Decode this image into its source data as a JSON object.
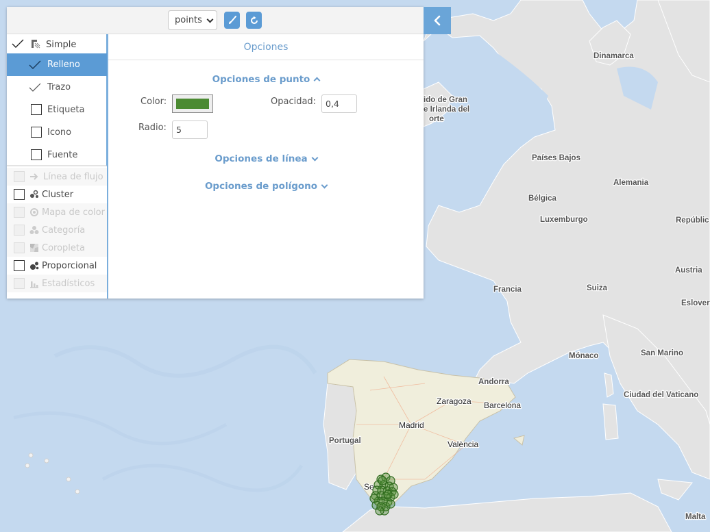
{
  "toolbar": {
    "layer_select_value": "points",
    "style_button_icon": "brush-icon",
    "reset_button_icon": "refresh-icon",
    "collapse_icon": "chevron-left-icon"
  },
  "sidebar": {
    "simple": {
      "label": "Simple",
      "checked": true
    },
    "subitems": [
      {
        "label": "Relleno",
        "checked": true,
        "active": true
      },
      {
        "label": "Trazo",
        "checked": true,
        "active": false
      },
      {
        "label": "Etiqueta",
        "checked": false,
        "active": false
      },
      {
        "label": "Icono",
        "checked": false,
        "active": false
      },
      {
        "label": "Fuente",
        "checked": false,
        "active": false
      }
    ],
    "types": [
      {
        "label": "Línea de flujo",
        "enabled": false,
        "icon": "arrow-right-icon"
      },
      {
        "label": "Cluster",
        "enabled": true,
        "icon": "cluster-icon"
      },
      {
        "label": "Mapa de color",
        "enabled": false,
        "icon": "heatmap-icon"
      },
      {
        "label": "Categoría",
        "enabled": false,
        "icon": "category-icon"
      },
      {
        "label": "Coropleta",
        "enabled": false,
        "icon": "choropleth-icon"
      },
      {
        "label": "Proporcional",
        "enabled": true,
        "icon": "proportional-icon"
      },
      {
        "label": "Estadísticos",
        "enabled": false,
        "icon": "bar-chart-icon"
      }
    ]
  },
  "options": {
    "header": "Opciones",
    "point_section": "Opciones de punto",
    "color_label": "Color:",
    "color_value": "#4b8a32",
    "opacity_label": "Opacidad:",
    "opacity_value": "0,4",
    "radius_label": "Radio:",
    "radius_value": "5",
    "line_section": "Opciones de línea",
    "polygon_section": "Opciones de polígono"
  },
  "map": {
    "labels": {
      "dinamarca": "Dinamarca",
      "uk_1": "ido de Gran",
      "uk_2": "e Irlanda del",
      "uk_3": "orte",
      "paises_bajos": "Países Bajos",
      "alemania": "Alemania",
      "belgica": "Bélgica",
      "luxemburgo": "Luxemburgo",
      "republica": "Repúblic",
      "austria": "Austria",
      "francia": "Francia",
      "suiza": "Suiza",
      "eslovenia": "Eslover",
      "monaco": "Mónaco",
      "san_marino": "San Marino",
      "andorra": "Andorra",
      "ciudad_vaticano": "Ciudad del Vaticano",
      "zaragoza": "Zaragoza",
      "barcelona": "Barcelona",
      "portugal": "Portugal",
      "madrid": "Madrid",
      "valencia": "València",
      "sevilla": "Se",
      "malta": "Malta"
    },
    "point_color": "#4b8a32",
    "point_opacity": 0.4
  }
}
